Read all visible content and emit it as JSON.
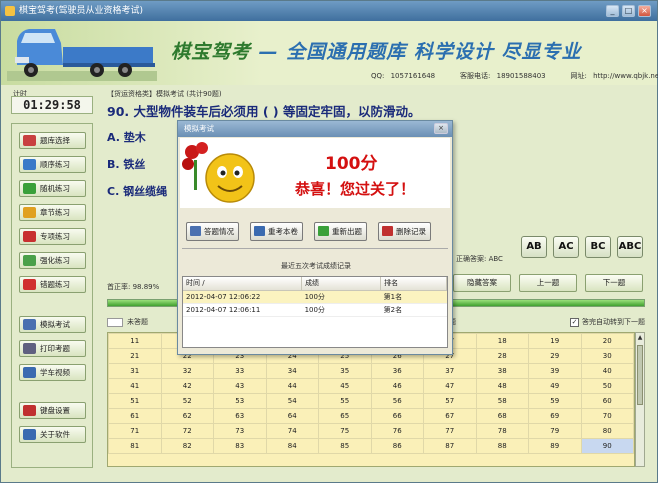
{
  "window": {
    "title": "棋宝驾考(驾驶员从业资格考试)",
    "minimize": "_",
    "restore": "□",
    "close": "×"
  },
  "banner": {
    "brand": "棋宝驾考",
    "slogan": "— 全国通用题库  科学设计  尽显专业",
    "qq": "QQ: 1057161648",
    "phone": "客服电话: 18901588403",
    "site": "网址: http://www.qbjk.net"
  },
  "timer": {
    "label": "计时",
    "value": "01:29:58"
  },
  "sidebar": {
    "items": [
      {
        "label": "题库选择",
        "color": "#c84040"
      },
      {
        "label": "顺序练习",
        "color": "#3a7ac8"
      },
      {
        "label": "随机练习",
        "color": "#3aa03a"
      },
      {
        "label": "章节练习",
        "color": "#e0a020"
      },
      {
        "label": "专项练习",
        "color": "#c83030"
      },
      {
        "label": "强化练习",
        "color": "#4aa04a"
      },
      {
        "label": "错题练习",
        "color": "#d03030"
      },
      {
        "label": "模拟考试",
        "color": "#4a70b0"
      },
      {
        "label": "打印考题",
        "color": "#606080"
      },
      {
        "label": "学车视频",
        "color": "#3a6ab0"
      },
      {
        "label": "键盘设置",
        "color": "#c03030"
      },
      {
        "label": "关于软件",
        "color": "#3a6ab0"
      }
    ]
  },
  "question": {
    "header": "【货运资格类】模拟考试 (共计90题)",
    "text": "90. 大型物件装车后必须用 ( ) 等固定牢固，以防滑动。",
    "options": [
      "A. 垫木",
      "B. 铁丝",
      "C. 钢丝缆绳"
    ],
    "correct_answer": "正确答案: ABC",
    "answer_buttons": [
      "AB",
      "AC",
      "BC",
      "ABC"
    ],
    "accuracy": "首正率: 98.89%",
    "hide_answer": "隐藏答案",
    "prev": "上一题",
    "next": "下一题",
    "progress_percent": 100,
    "legend_unanswered": "未答题",
    "legend_answered": "题",
    "auto_next": "答完自动转到下一题",
    "auto_next_check": "✓"
  },
  "grid": {
    "rows": [
      [
        11,
        12,
        13,
        14,
        15,
        16,
        17,
        18,
        19,
        20
      ],
      [
        21,
        22,
        23,
        24,
        25,
        26,
        27,
        28,
        29,
        30
      ],
      [
        31,
        32,
        33,
        34,
        35,
        36,
        37,
        38,
        39,
        40
      ],
      [
        41,
        42,
        43,
        44,
        45,
        46,
        47,
        48,
        49,
        50
      ],
      [
        51,
        52,
        53,
        54,
        55,
        56,
        57,
        58,
        59,
        60
      ],
      [
        61,
        62,
        63,
        64,
        65,
        66,
        67,
        68,
        69,
        70
      ],
      [
        71,
        72,
        73,
        74,
        75,
        76,
        77,
        78,
        79,
        80
      ],
      [
        81,
        82,
        83,
        84,
        85,
        86,
        87,
        88,
        89,
        90
      ]
    ],
    "selected": 90
  },
  "dialog": {
    "title": "模拟考试",
    "close": "×",
    "score": "100分",
    "congrats": "恭喜！您过关了！",
    "buttons": [
      {
        "label": "答题情况",
        "color": "#4a70b0"
      },
      {
        "label": "重考本卷",
        "color": "#3a6ab0"
      },
      {
        "label": "重新出题",
        "color": "#3aa03a"
      },
      {
        "label": "删除记录",
        "color": "#c03030"
      }
    ],
    "records_title": "最近五次考试成绩记录",
    "columns": [
      "时间 /",
      "成绩",
      "排名"
    ],
    "records": [
      [
        "2012-04-07 12:06:22",
        "100分",
        "第1名"
      ],
      [
        "2012-04-07 12:06:11",
        "100分",
        "第2名"
      ]
    ]
  }
}
